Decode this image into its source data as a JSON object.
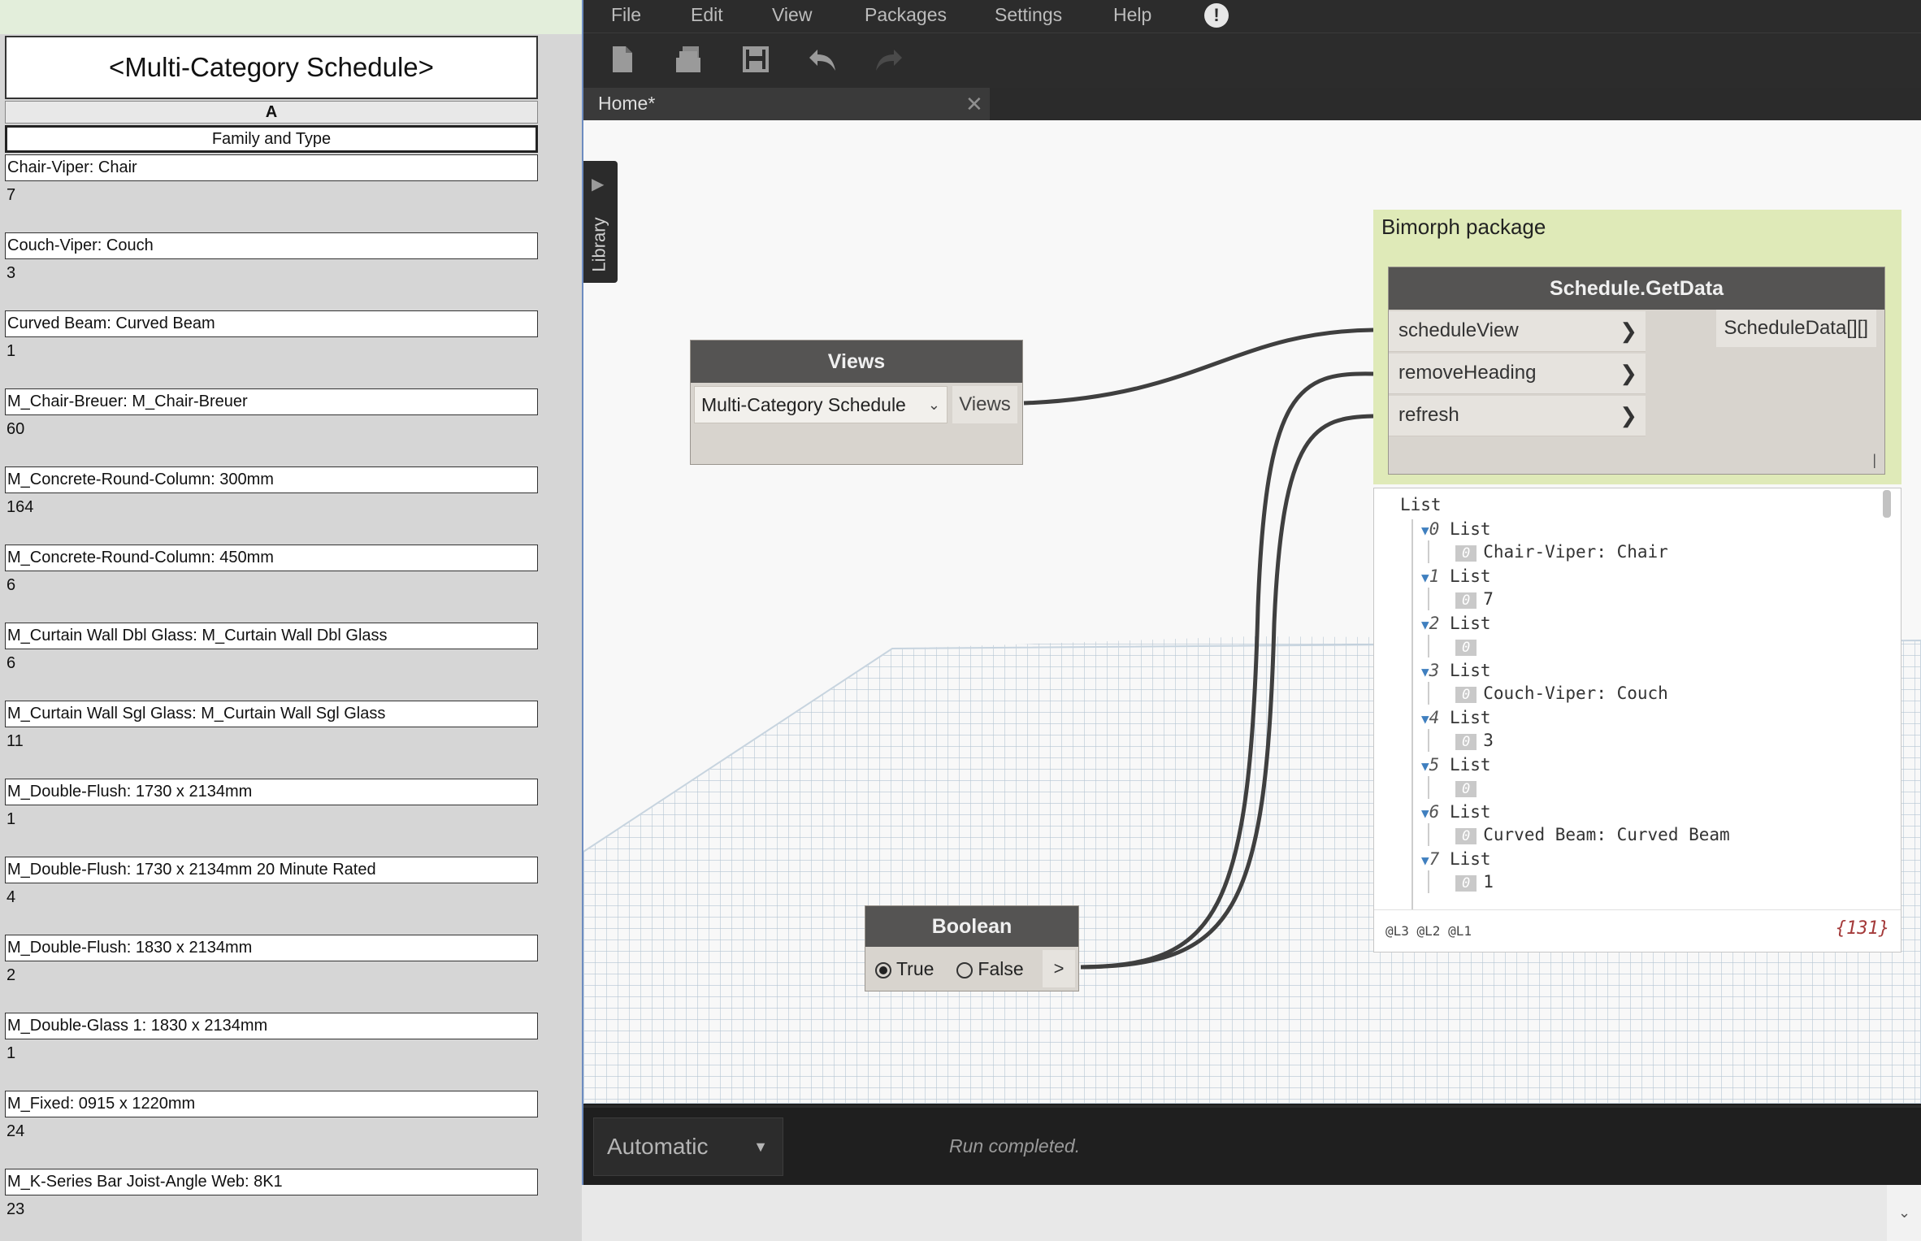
{
  "schedule": {
    "title": "<Multi-Category Schedule>",
    "column_letter": "A",
    "column_header": "Family and Type",
    "rows": [
      {
        "name": "Chair-Viper: Chair",
        "count": "7"
      },
      {
        "name": "Couch-Viper: Couch",
        "count": "3"
      },
      {
        "name": "Curved Beam: Curved Beam",
        "count": "1"
      },
      {
        "name": "M_Chair-Breuer: M_Chair-Breuer",
        "count": "60"
      },
      {
        "name": "M_Concrete-Round-Column: 300mm",
        "count": "164"
      },
      {
        "name": "M_Concrete-Round-Column: 450mm",
        "count": "6"
      },
      {
        "name": "M_Curtain Wall Dbl Glass: M_Curtain Wall Dbl Glass",
        "count": "6"
      },
      {
        "name": "M_Curtain Wall Sgl Glass: M_Curtain Wall Sgl Glass",
        "count": "11"
      },
      {
        "name": "M_Double-Flush: 1730 x 2134mm",
        "count": "1"
      },
      {
        "name": "M_Double-Flush: 1730 x 2134mm 20 Minute Rated",
        "count": "4"
      },
      {
        "name": "M_Double-Flush: 1830 x 2134mm",
        "count": "2"
      },
      {
        "name": "M_Double-Glass 1: 1830 x 2134mm",
        "count": "1"
      },
      {
        "name": "M_Fixed: 0915 x 1220mm",
        "count": "24"
      },
      {
        "name": "M_K-Series Bar Joist-Angle Web: 8K1",
        "count": "23"
      }
    ]
  },
  "dynamo": {
    "menu": [
      "File",
      "Edit",
      "View",
      "Packages",
      "Settings",
      "Help"
    ],
    "alert_icon": "!",
    "toolbar_icons": [
      "new-file-icon",
      "open-file-icon",
      "save-icon",
      "undo-icon",
      "redo-icon"
    ],
    "tab": {
      "label": "Home*",
      "close": "✕"
    },
    "library_label": "Library",
    "views_node": {
      "title": "Views",
      "selected": "Multi-Category Schedule",
      "output": "Views"
    },
    "group": {
      "title": "Bimorph package"
    },
    "getdata_node": {
      "title": "Schedule.GetData",
      "inputs": [
        "scheduleView",
        "removeHeading",
        "refresh"
      ],
      "output": "ScheduleData[][]"
    },
    "boolean_node": {
      "title": "Boolean",
      "true_label": "True",
      "false_label": "False",
      "selected": "True",
      "output": ">"
    },
    "watch": {
      "root": "List",
      "items": [
        {
          "index": "0",
          "label": "List",
          "value_index": "0",
          "value": "Chair-Viper: Chair"
        },
        {
          "index": "1",
          "label": "List",
          "value_index": "0",
          "value": "7"
        },
        {
          "index": "2",
          "label": "List",
          "value_index": "0",
          "value": ""
        },
        {
          "index": "3",
          "label": "List",
          "value_index": "0",
          "value": "Couch-Viper: Couch"
        },
        {
          "index": "4",
          "label": "List",
          "value_index": "0",
          "value": "3"
        },
        {
          "index": "5",
          "label": "List",
          "value_index": "0",
          "value": ""
        },
        {
          "index": "6",
          "label": "List",
          "value_index": "0",
          "value": "Curved Beam: Curved Beam"
        },
        {
          "index": "7",
          "label": "List",
          "value_index": "0",
          "value": "1"
        }
      ],
      "levels": "@L3 @L2 @L1",
      "count": "{131}"
    },
    "run_mode": "Automatic",
    "run_status": "Run completed."
  }
}
